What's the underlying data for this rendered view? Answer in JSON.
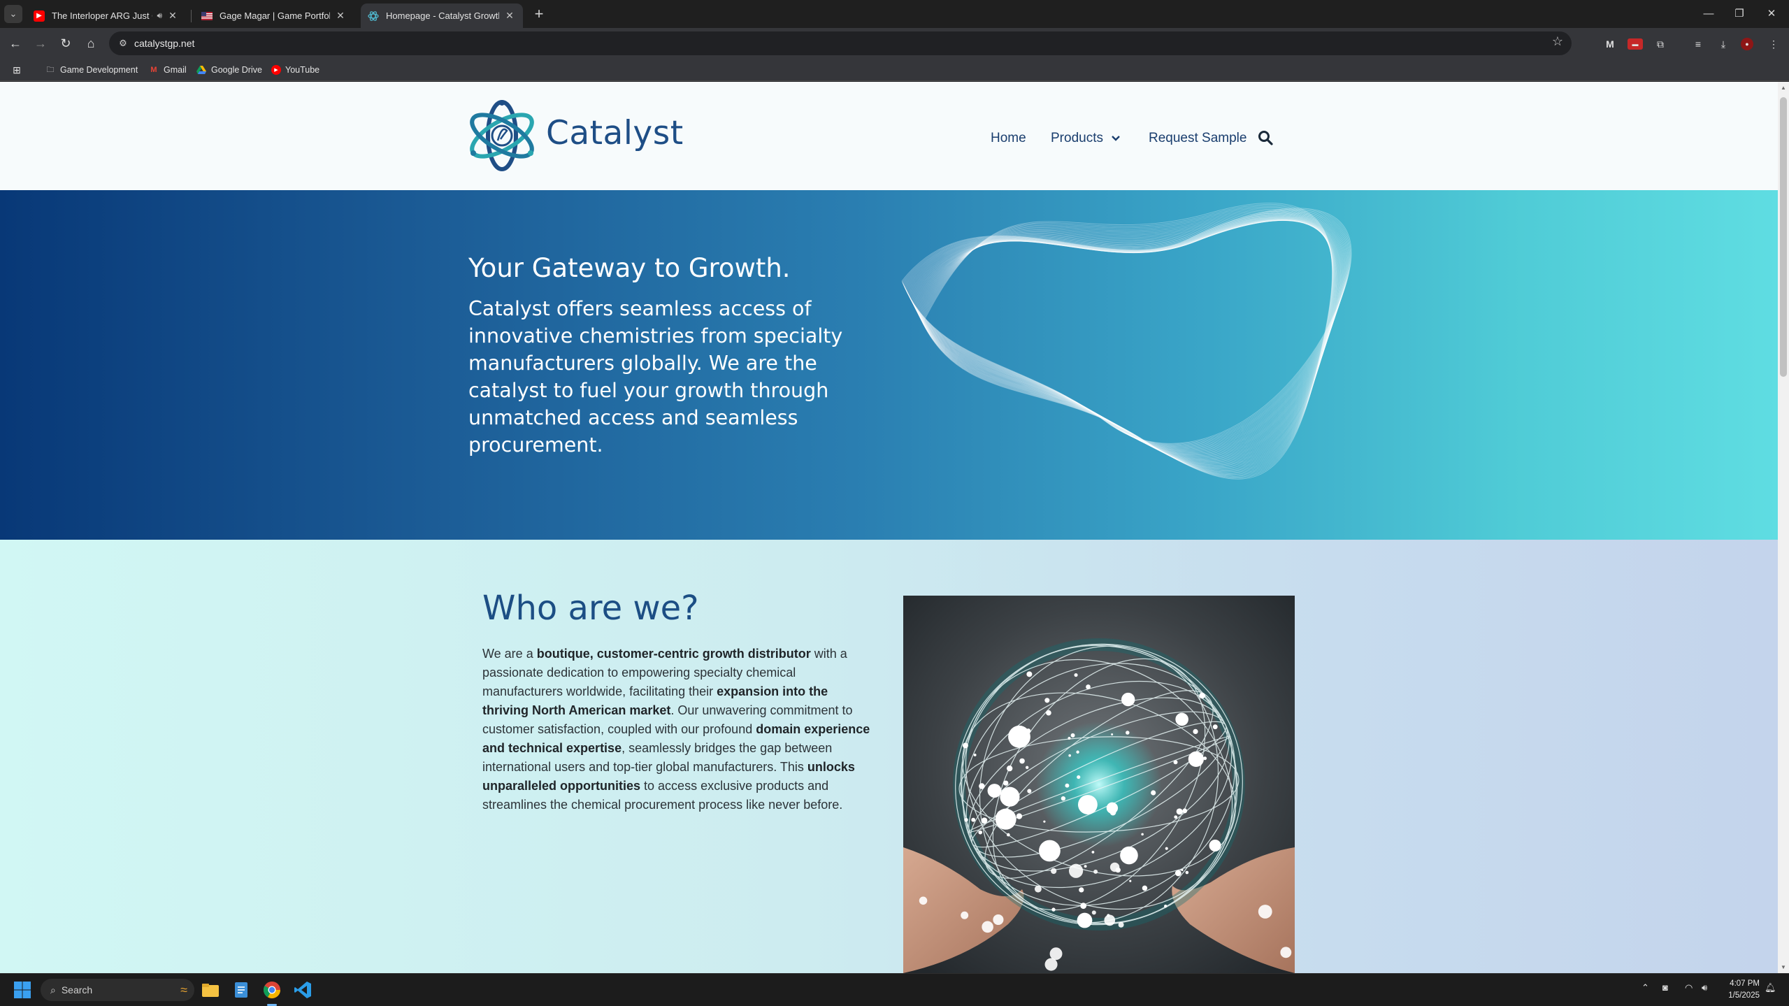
{
  "browser": {
    "tabs": [
      {
        "title": "The Interloper ARG Just Got",
        "favicon": "youtube-icon",
        "audio": true,
        "active": false
      },
      {
        "title": "Gage Magar | Game Portfolio",
        "favicon": "flag-icon",
        "audio": false,
        "active": false
      },
      {
        "title": "Homepage - Catalyst Growth P",
        "favicon": "catalyst-icon",
        "audio": false,
        "active": true
      }
    ],
    "url": "catalystgp.net",
    "bookmarks": [
      {
        "label": "Game Development",
        "icon": "folder-icon"
      },
      {
        "label": "Gmail",
        "icon": "gmail-icon"
      },
      {
        "label": "Google Drive",
        "icon": "drive-icon"
      },
      {
        "label": "YouTube",
        "icon": "youtube-icon"
      }
    ]
  },
  "site": {
    "logo_text": "Catalyst",
    "nav": {
      "home": "Home",
      "products": "Products",
      "request_sample": "Request Sample"
    },
    "hero": {
      "title": "Your Gateway to Growth.",
      "body": "Catalyst offers seamless access of innovative chemistries from specialty manufacturers globally.  We are the catalyst to fuel your growth through unmatched access and seamless procurement."
    },
    "who": {
      "title": "Who are we?",
      "segments": [
        {
          "text": "We are a ",
          "bold": false
        },
        {
          "text": "boutique, customer-centric growth distributor",
          "bold": true
        },
        {
          "text": " with a passionate dedication to empowering specialty chemical manufacturers worldwide, facilitating their ",
          "bold": false
        },
        {
          "text": "expansion into the thriving North American market",
          "bold": true
        },
        {
          "text": ". Our unwavering commitment to customer satisfaction, coupled with our profound ",
          "bold": false
        },
        {
          "text": "domain experience and technical expertise",
          "bold": true
        },
        {
          "text": ", seamlessly bridges the gap between international users and top-tier global manufacturers. This ",
          "bold": false
        },
        {
          "text": "unlocks unparalleled opportunities",
          "bold": true
        },
        {
          "text": " to access exclusive products and streamlines the chemical procurement process like never before.",
          "bold": false
        }
      ]
    }
  },
  "taskbar": {
    "search_label": "Search",
    "time": "4:07 PM",
    "date": "1/5/2025"
  },
  "colors": {
    "brand_blue": "#1e4e86",
    "brand_teal": "#2aa6b0",
    "hero_start": "#083877",
    "hero_end": "#5fdde2"
  }
}
